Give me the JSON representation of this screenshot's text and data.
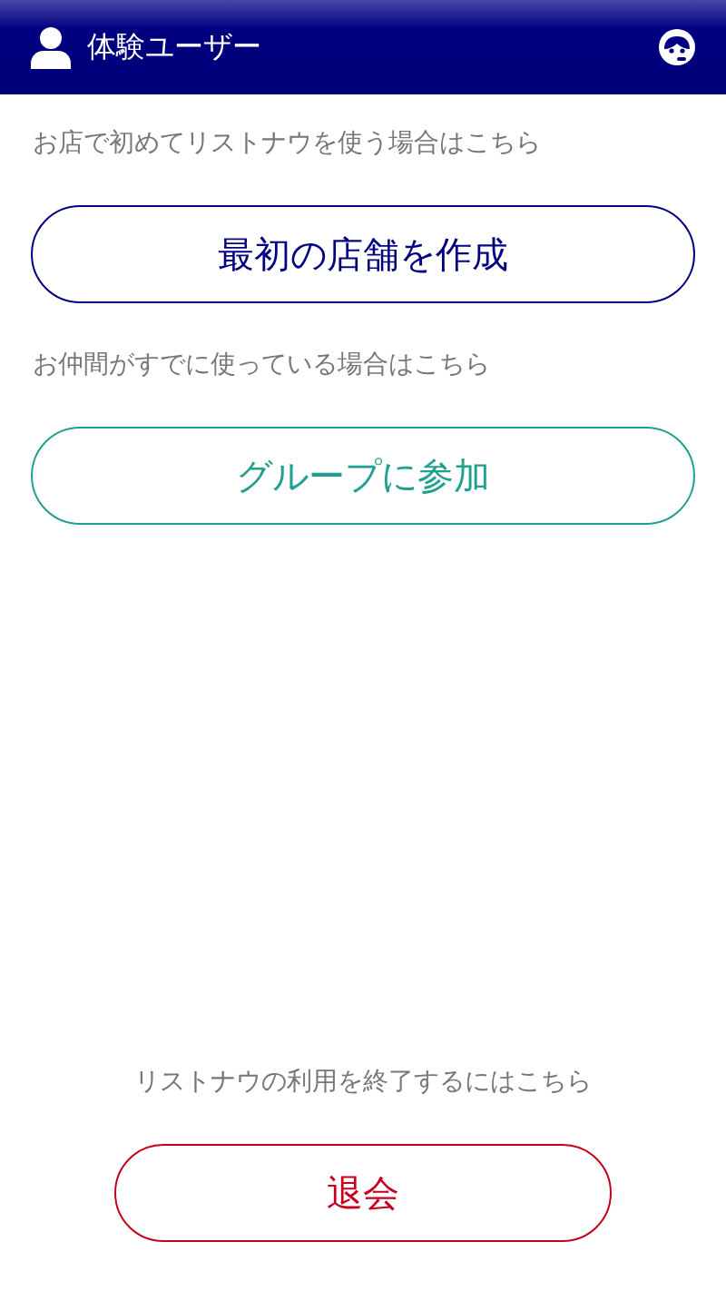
{
  "header": {
    "title": "体験ユーザー"
  },
  "sections": [
    {
      "note": "お店で初めてリストナウを使う場合はこちら",
      "button": "最初の店舗を作成",
      "kind": "primary"
    },
    {
      "note": "お仲間がすでに使っている場合はこちら",
      "button": "グループに参加",
      "kind": "secondary"
    }
  ],
  "footer": {
    "note": "リストナウの利用を終了するにはこちら",
    "button": "退会",
    "kind": "danger"
  }
}
